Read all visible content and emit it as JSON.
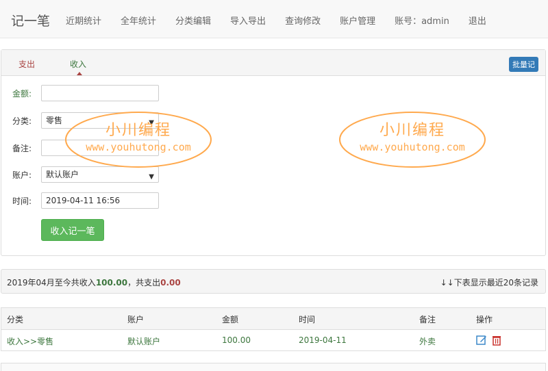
{
  "nav": {
    "brand": "记一笔",
    "items": [
      "近期统计",
      "全年统计",
      "分类编辑",
      "导入导出",
      "查询修改",
      "账户管理",
      "账号：admin",
      "退出"
    ]
  },
  "tabs": {
    "expense": "支出",
    "income": "收入",
    "batch": "批量记"
  },
  "form": {
    "amount_label": "金额:",
    "amount_value": "",
    "category_label": "分类:",
    "category_value": "零售",
    "note_label": "备注:",
    "note_value": "",
    "account_label": "账户:",
    "account_value": "默认账户",
    "time_label": "时间:",
    "time_value": "2019-04-11 16:56",
    "submit": "收入记一笔"
  },
  "summary": {
    "prefix": "2019年04月至今共收入",
    "income_total": "100.00",
    "mid": "，共支出",
    "expense_total": "0.00",
    "note": "↓↓下表显示最近20条记录"
  },
  "table": {
    "headers": [
      "分类",
      "账户",
      "金额",
      "时间",
      "备注",
      "操作"
    ],
    "rows": [
      {
        "category": "收入>>零售",
        "account": "默认账户",
        "amount": "100.00",
        "time": "2019-04-11",
        "note": "外卖"
      }
    ]
  },
  "watermark": {
    "title": "小川编程",
    "url": "www.youhutong.com"
  },
  "colors": {
    "income": "#3c763d",
    "expense": "#a94442",
    "primary": "#337ab7",
    "success": "#5cb85c",
    "watermark": "#ffa94d"
  },
  "icons": [
    "edit-icon",
    "delete-icon",
    "chevron-down-icon"
  ]
}
